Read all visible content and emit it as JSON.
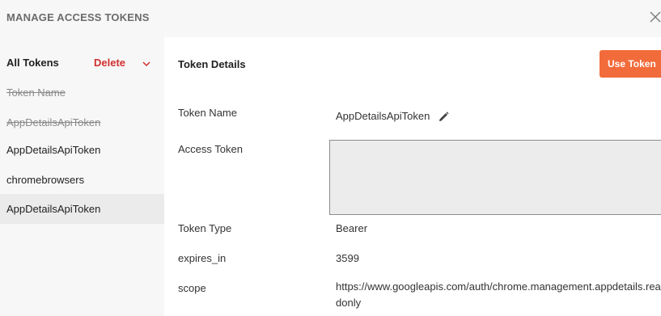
{
  "header": {
    "title": "MANAGE ACCESS TOKENS",
    "close_icon": "close-icon"
  },
  "sidebar": {
    "all_tokens_label": "All Tokens",
    "delete_label": "Delete",
    "delete_icon": "chevron-down-icon",
    "items": [
      {
        "label": "Token Name",
        "state": "strikethrough"
      },
      {
        "label": "AppDetailsApiToken",
        "state": "strikethrough"
      },
      {
        "label": "AppDetailsApiToken",
        "state": "normal"
      },
      {
        "label": "chromebrowsers",
        "state": "normal"
      },
      {
        "label": "AppDetailsApiToken",
        "state": "selected"
      }
    ]
  },
  "details": {
    "title": "Token Details",
    "use_token_label": "Use Token",
    "fields": {
      "token_name": {
        "label": "Token Name",
        "value": "AppDetailsApiToken",
        "edit_icon": "pencil-icon"
      },
      "access_token": {
        "label": "Access Token",
        "value": ""
      },
      "token_type": {
        "label": "Token Type",
        "value": "Bearer"
      },
      "expires_in": {
        "label": "expires_in",
        "value": "3599"
      },
      "scope": {
        "label": "scope",
        "value": "https://www.googleapis.com/auth/chrome.management.appdetails.readonly"
      }
    }
  },
  "colors": {
    "accent_button": "#f26b3a",
    "delete_text": "#d32f2f",
    "sidebar_bg": "#f7f7f7",
    "selected_bg": "#ebebeb"
  }
}
